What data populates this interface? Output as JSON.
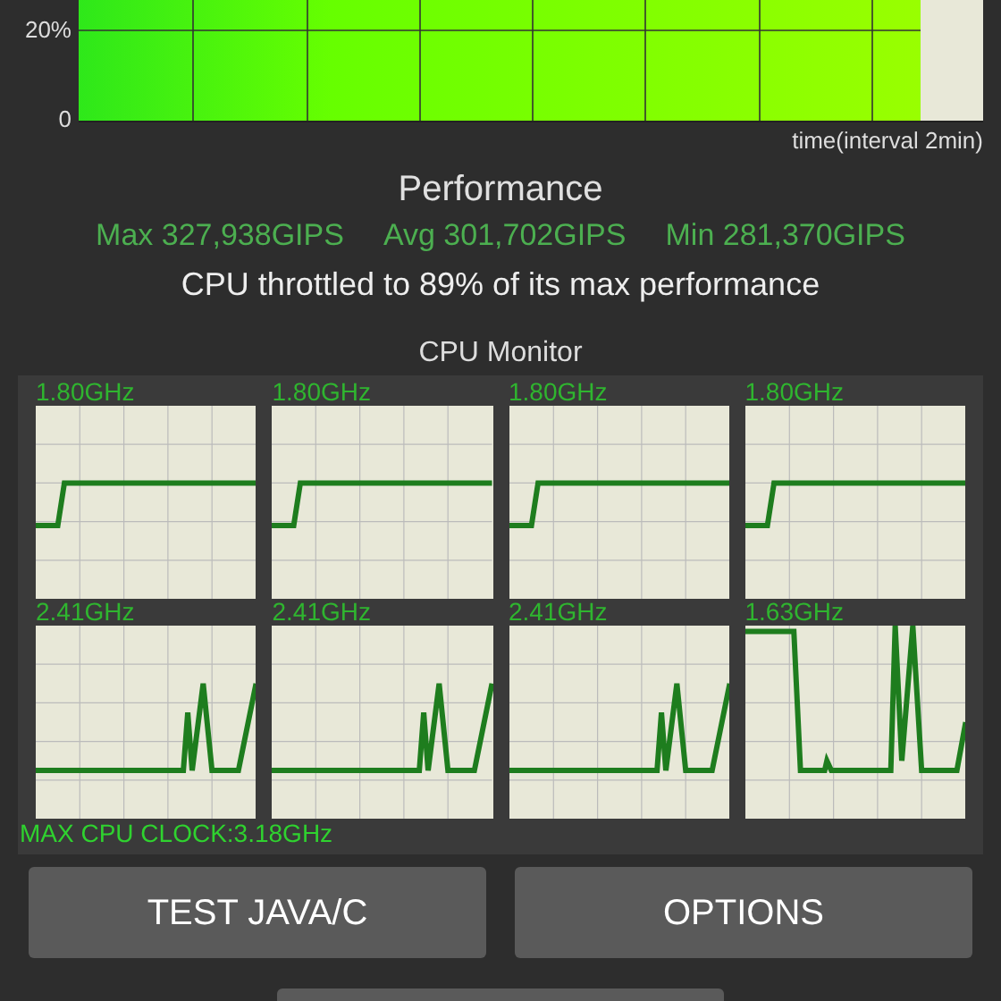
{
  "throughput_chart": {
    "y_tick_labels": [
      "20%",
      "0"
    ],
    "x_axis_label": "time(interval 2min)"
  },
  "performance": {
    "title": "Performance",
    "max": "Max 327,938GIPS",
    "avg": "Avg 301,702GIPS",
    "min": "Min 281,370GIPS",
    "throttle_note": "CPU throttled to 89% of its max performance"
  },
  "cpu_monitor": {
    "title": "CPU Monitor",
    "cores": [
      {
        "frequency": "1.80GHz"
      },
      {
        "frequency": "1.80GHz"
      },
      {
        "frequency": "1.80GHz"
      },
      {
        "frequency": "1.80GHz"
      },
      {
        "frequency": "2.41GHz"
      },
      {
        "frequency": "2.41GHz"
      },
      {
        "frequency": "2.41GHz"
      },
      {
        "frequency": "1.63GHz"
      }
    ],
    "max_clock": "MAX CPU CLOCK:3.18GHz"
  },
  "buttons": [
    "TEST JAVA/C",
    "OPTIONS"
  ]
}
